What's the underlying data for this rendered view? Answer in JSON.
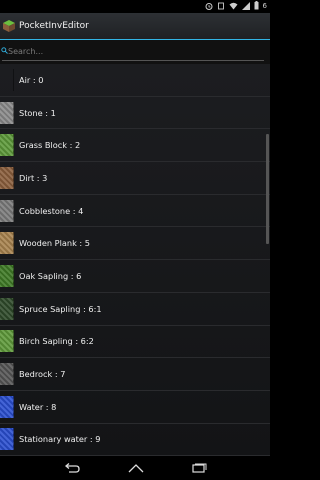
{
  "status": {
    "battery": "6"
  },
  "app": {
    "title": "PocketInvEditor"
  },
  "search": {
    "placeholder": "Search..."
  },
  "items": [
    {
      "label": "Air : 0",
      "color": "transparent"
    },
    {
      "label": "Stone : 1",
      "color": "#8a8a8a"
    },
    {
      "label": "Grass Block : 2",
      "color": "#5d9a3a"
    },
    {
      "label": "Dirt : 3",
      "color": "#8b5e3c"
    },
    {
      "label": "Cobblestone : 4",
      "color": "#7b7b7b"
    },
    {
      "label": "Wooden Plank : 5",
      "color": "#a8834f"
    },
    {
      "label": "Oak Sapling : 6",
      "color": "#3f7a25"
    },
    {
      "label": "Spruce Sapling : 6:1",
      "color": "#2f4a2a"
    },
    {
      "label": "Birch Sapling : 6:2",
      "color": "#5f9a3a"
    },
    {
      "label": "Bedrock : 7",
      "color": "#555555"
    },
    {
      "label": "Water : 8",
      "color": "#2a4fd0"
    },
    {
      "label": "Stationary water : 9",
      "color": "#2a4fd0"
    }
  ]
}
